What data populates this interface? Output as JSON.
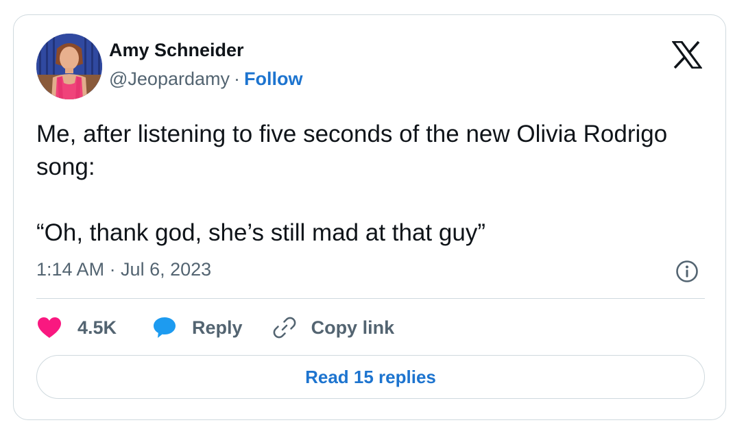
{
  "author": {
    "name": "Amy Schneider",
    "handle": "@Jeopardamy",
    "separator": "·",
    "follow_label": "Follow",
    "avatar_icon": "profile-photo"
  },
  "brand": {
    "logo_icon": "x-logo-icon"
  },
  "tweet": {
    "text": "Me, after listening to five seconds of the new Olivia Rodrigo song:\n\n“Oh, thank god, she’s still mad at that guy”",
    "timestamp": "1:14 AM · Jul 6, 2023"
  },
  "actions": {
    "like_count": "4.5K",
    "reply_label": "Reply",
    "copy_label": "Copy link"
  },
  "footer": {
    "read_replies_label": "Read 15 replies"
  },
  "colors": {
    "link_blue": "#1d74cf",
    "heart_pink": "#f91880",
    "reply_blue": "#1d9bf0",
    "muted_text": "#536471",
    "border": "#cfd9de"
  }
}
